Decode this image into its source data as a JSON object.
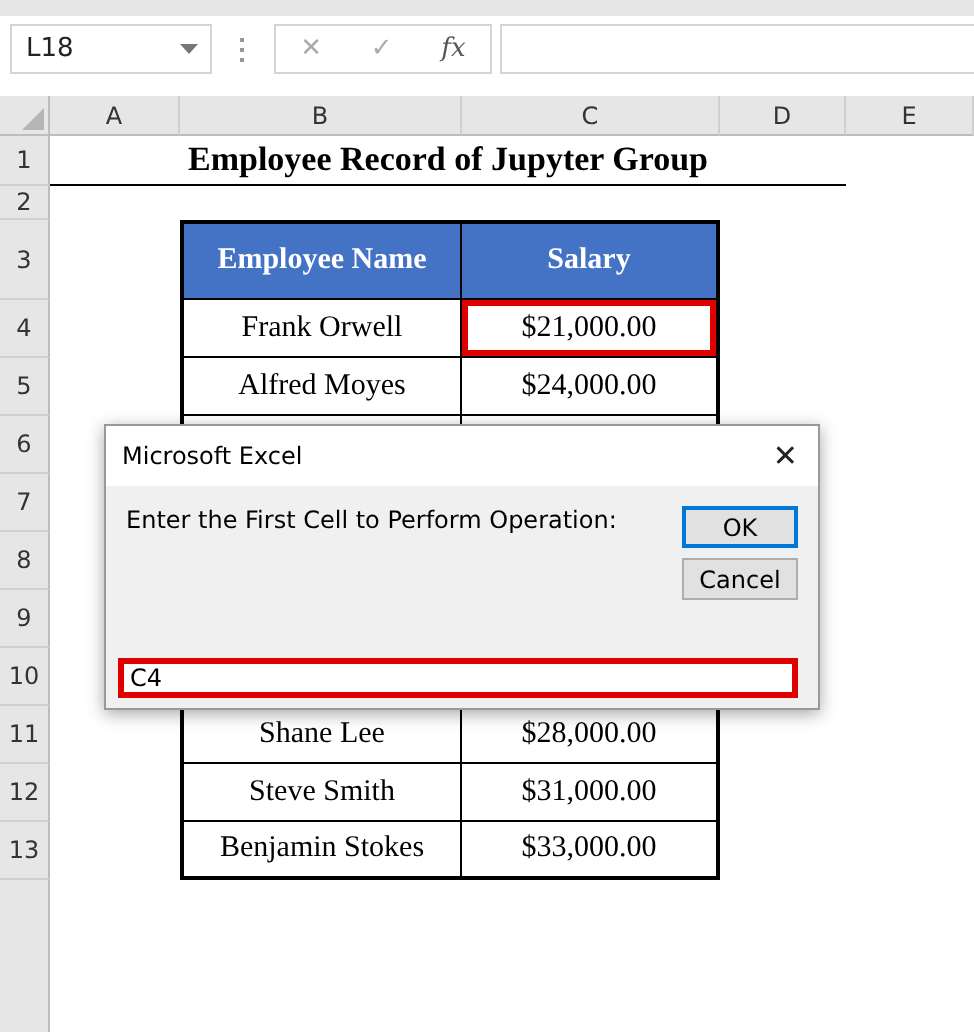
{
  "formula_bar": {
    "name_box": "L18",
    "cancel": "✕",
    "enter": "✓",
    "function": "fx"
  },
  "columns": [
    "A",
    "B",
    "C",
    "D",
    "E"
  ],
  "row_numbers": [
    "1",
    "2",
    "3",
    "4",
    "5",
    "6",
    "7",
    "8",
    "9",
    "10",
    "11",
    "12",
    "13"
  ],
  "title": "Employee Record of Jupyter Group",
  "table": {
    "columns": [
      "Employee Name",
      "Salary"
    ],
    "rows": [
      {
        "kind": "data",
        "name": "Frank Orwell",
        "salary": "$21,000.00",
        "highlighted": true
      },
      {
        "kind": "data",
        "name": "Alfred Moyes",
        "salary": "$24,000.00",
        "highlighted": false
      },
      {
        "kind": "covered"
      },
      {
        "kind": "covered"
      },
      {
        "kind": "covered"
      },
      {
        "kind": "covered"
      },
      {
        "kind": "covered"
      },
      {
        "kind": "data",
        "name": "Shane Lee",
        "salary": "$28,000.00",
        "highlighted": false
      },
      {
        "kind": "data",
        "name": "Steve Smith",
        "salary": "$31,000.00",
        "highlighted": false
      },
      {
        "kind": "data",
        "name": "Benjamin Stokes",
        "salary": "$33,000.00",
        "highlighted": false
      }
    ]
  },
  "dialog": {
    "title": "Microsoft Excel",
    "close": "✕",
    "prompt": "Enter the First Cell to Perform Operation:",
    "buttons": [
      {
        "label": "OK",
        "focused": true
      },
      {
        "label": "Cancel",
        "focused": false
      }
    ],
    "input": {
      "value": "C4",
      "highlighted": true
    }
  }
}
